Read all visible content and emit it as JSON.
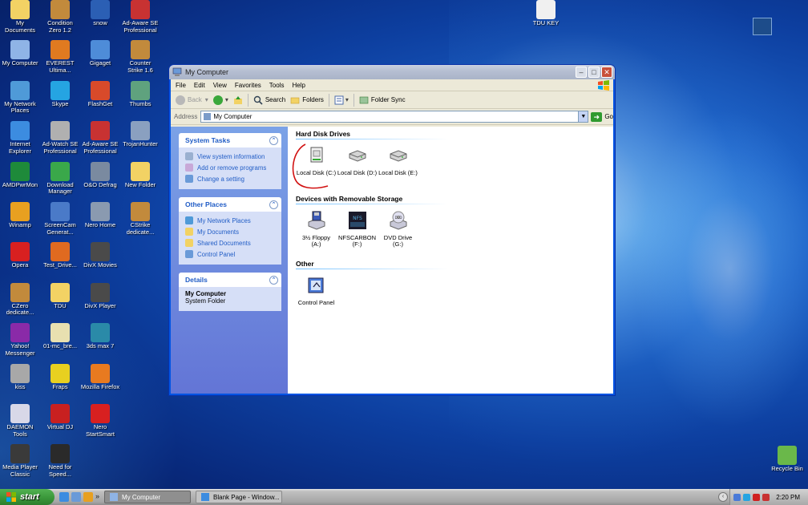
{
  "desktop": {
    "icons": [
      {
        "label": "My\nDocuments",
        "icon": "my-documents-icon",
        "color": "#f2d264"
      },
      {
        "label": "Condition\nZero 1.2",
        "icon": "cs-soldier-icon",
        "color": "#c28a3c"
      },
      {
        "label": "snow",
        "icon": "snow-s-icon",
        "color": "#2b5fb4"
      },
      {
        "label": "Ad-Aware SE\nProfessional",
        "icon": "ad-aware-icon",
        "color": "#c83232"
      },
      {
        "label": "My Computer",
        "icon": "my-computer-icon",
        "color": "#8fb4e6"
      },
      {
        "label": "EVEREST\nUltima...",
        "icon": "everest-icon",
        "color": "#e07a20"
      },
      {
        "label": "Gigaget",
        "icon": "gigaget-icon",
        "color": "#4e8cd8"
      },
      {
        "label": "Counter\nStrike 1.6",
        "icon": "cs-soldier-icon",
        "color": "#c28a3c"
      },
      {
        "label": "My Network\nPlaces",
        "icon": "network-places-icon",
        "color": "#4f9ad8"
      },
      {
        "label": "Skype",
        "icon": "skype-icon",
        "color": "#25a4e2"
      },
      {
        "label": "FlashGet",
        "icon": "flashget-icon",
        "color": "#d84a2a"
      },
      {
        "label": "Thumbs",
        "icon": "thumbs-icon",
        "color": "#5fa27e"
      },
      {
        "label": "Internet\nExplorer",
        "icon": "internet-explorer-icon",
        "color": "#3c8ce0"
      },
      {
        "label": "Ad-Watch SE\nProfessional",
        "icon": "ad-watch-icon",
        "color": "#b0b0b0"
      },
      {
        "label": "Ad-Aware SE\nProfessional",
        "icon": "ad-aware-icon",
        "color": "#c83232"
      },
      {
        "label": "TrojanHunter",
        "icon": "trojanhunter-icon",
        "color": "#8aa0c0"
      },
      {
        "label": "AMDPwrMon",
        "icon": "amd-icon",
        "color": "#1e8a3a"
      },
      {
        "label": "Download\nManager",
        "icon": "download-manager-icon",
        "color": "#3aa84a"
      },
      {
        "label": "O&O Defrag",
        "icon": "defrag-icon",
        "color": "#7a8aa0"
      },
      {
        "label": "New Folder",
        "icon": "folder-icon",
        "color": "#f2d264"
      },
      {
        "label": "Winamp",
        "icon": "winamp-icon",
        "color": "#e8a020"
      },
      {
        "label": "ScreenCam\nGenerat...",
        "icon": "screencam-icon",
        "color": "#4a7ac8"
      },
      {
        "label": "Nero Home",
        "icon": "nero-home-icon",
        "color": "#8a9ab0"
      },
      {
        "label": "CStrike\ndedicate...",
        "icon": "cs-soldier-icon",
        "color": "#c28a3c"
      },
      {
        "label": "Opera",
        "icon": "opera-icon",
        "color": "#d82020"
      },
      {
        "label": "Test_Drive...",
        "icon": "test-drive-icon",
        "color": "#e06a20"
      },
      {
        "label": "DivX Movies",
        "icon": "divx-icon",
        "color": "#4a4a4a"
      },
      {
        "label": "CZero\ndedicate...",
        "icon": "cs-soldier-icon",
        "color": "#c28a3c"
      },
      {
        "label": "TDU",
        "icon": "folder-icon",
        "color": "#f2d264"
      },
      {
        "label": "DivX Player",
        "icon": "divx-icon",
        "color": "#4a4a4a"
      },
      {
        "label": "Yahoo!\nMessenger",
        "icon": "yahoo-icon",
        "color": "#8a2aa8"
      },
      {
        "label": "01-mc_bre...",
        "icon": "audio-file-icon",
        "color": "#e8e0b0"
      },
      {
        "label": "3ds max 7",
        "icon": "3ds-max-icon",
        "color": "#2a8aa8"
      },
      {
        "label": "kiss",
        "icon": "kiss-icon",
        "color": "#a8a8a8"
      },
      {
        "label": "Fraps",
        "icon": "fraps-icon",
        "color": "#e8d020"
      },
      {
        "label": "Mozilla Firefox",
        "icon": "firefox-icon",
        "color": "#e87a20"
      },
      {
        "label": "DAEMON\nTools",
        "icon": "daemon-tools-icon",
        "color": "#d8d8e8"
      },
      {
        "label": "Virtual DJ",
        "icon": "virtual-dj-icon",
        "color": "#c82020"
      },
      {
        "label": "Nero\nStartSmart",
        "icon": "nero-icon",
        "color": "#d82020"
      },
      {
        "label": "Media Player\nClassic",
        "icon": "media-player-icon",
        "color": "#3a3a3a"
      },
      {
        "label": "Need for\nSpeed...",
        "icon": "nfs-icon",
        "color": "#2a2a2a"
      },
      {
        "label": "TDU KEY",
        "icon": "text-document-icon",
        "color": "#f0f0f0"
      },
      {
        "label": "Recycle Bin",
        "icon": "recycle-bin-icon",
        "color": "#6ab84a"
      }
    ]
  },
  "window": {
    "title": "My Computer",
    "menu": [
      "File",
      "Edit",
      "View",
      "Favorites",
      "Tools",
      "Help"
    ],
    "toolbar": {
      "back": "Back",
      "search": "Search",
      "folders": "Folders",
      "folder_sync": "Folder Sync"
    },
    "address": {
      "label": "Address",
      "value": "My Computer",
      "go": "Go"
    },
    "task_panels": [
      {
        "title": "System Tasks",
        "items": [
          "View system information",
          "Add or remove programs",
          "Change a setting"
        ]
      },
      {
        "title": "Other Places",
        "items": [
          "My Network Places",
          "My Documents",
          "Shared Documents",
          "Control Panel"
        ]
      }
    ],
    "details": {
      "title": "Details",
      "name": "My Computer",
      "sub": "System Folder"
    },
    "sections": [
      {
        "title": "Hard Disk Drives",
        "items": [
          "Local Disk (C:)",
          "Local Disk (D:)",
          "Local Disk (E:)"
        ]
      },
      {
        "title": "Devices with Removable Storage",
        "items": [
          "3½ Floppy\n(A:)",
          "NFSCARBON\n(F:)",
          "DVD Drive\n(G:)"
        ]
      },
      {
        "title": "Other",
        "items": [
          "Control Panel"
        ]
      }
    ]
  },
  "taskbar": {
    "start": "start",
    "tasks": [
      "My Computer",
      "Blank Page - Window..."
    ],
    "clock": "2:20 PM"
  },
  "colors": {
    "taskpane_text": "#215dc6",
    "start_green": "#3c9a3c",
    "annotation_red": "#d11111"
  }
}
